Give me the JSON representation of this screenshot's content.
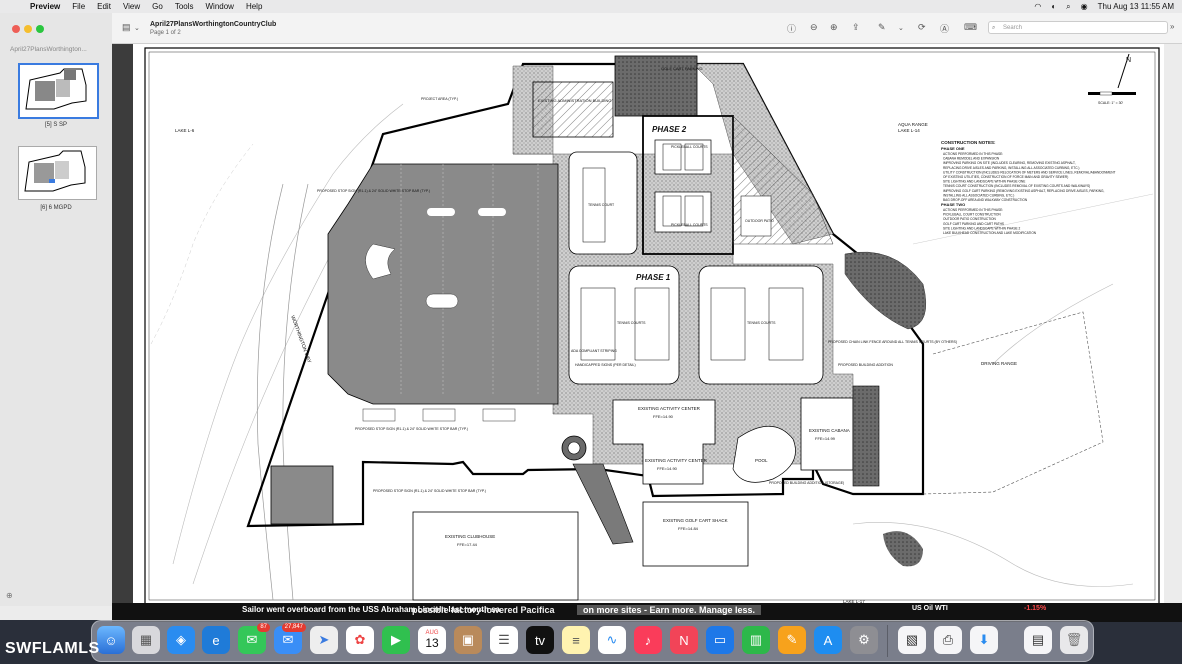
{
  "menubar": {
    "apple": "",
    "items": [
      "Preview",
      "File",
      "Edit",
      "View",
      "Go",
      "Tools",
      "Window",
      "Help"
    ],
    "clock": "Thu Aug 13  11:55 AM"
  },
  "sidebar": {
    "title": "April27PlansWorthington...",
    "thumbs": [
      {
        "label": "[5] S SP"
      },
      {
        "label": "[6] 6 MGPD"
      }
    ]
  },
  "toolbar": {
    "title": "April27PlansWorthingtonCountryClub",
    "subtitle": "Page 1 of 2",
    "search_placeholder": "Search"
  },
  "plan": {
    "phase1": "PHASE 1",
    "phase2": "PHASE 2",
    "admin": "EXISTING ADMINISTRATION BUILDING",
    "golf_cart_parking": "GOLF CART PARKING",
    "pickleball": "PICKLEBALL COURTS",
    "pickleball2": "PICKLEBALL COURTS",
    "outdoor_patio": "OUTDOOR PATIO",
    "tennis_court": "TENNIS COURT",
    "tennis_courts": "TENNIS COURTS",
    "tennis_courts2": "TENNIS COURTS",
    "activity1": "EXISTING ACTIVITY CENTER",
    "activity1_ffe": "FFE=14.90",
    "activity2": "EXISTING ACTIVITY CENTER",
    "activity2_ffe": "FFE=14.90",
    "pool": "POOL",
    "cabana": "EXISTING CABANA",
    "cabana_ffe": "FFE=14.99",
    "clubhouse": "EXISTING CLUBHOUSE",
    "clubhouse_ffe": "FFE=17.44",
    "cart_shack": "EXISTING GOLF CART SHACK",
    "cart_shack_ffe": "FFE=14.84",
    "driving_range": "DRIVING RANGE",
    "aqua_range": "AQUA RANGE",
    "lake_l14": "LAKE L-14",
    "lake_l6": "LAKE L-6",
    "lake_l17": "LAKE L-17",
    "worthington_way": "WORTHINGTON WAY",
    "project_area": "PROJECT AREA (TYP.)",
    "stop_sign": "PROPOSED STOP SIGN (R1-1) & 24\" SOLID WHITE STOP BAR (TYP.)",
    "ada_striping": "ADA COMPLIANT STRIPING",
    "hc_signs": "HANDICAPPED SIGNS (PER DETAIL)",
    "chain_fence": "PROPOSED CHAIN LINK FENCE AROUND ALL TENNIS COURTS (BY OTHERS)",
    "bldg_addition": "PROPOSED BUILDING ADDITION",
    "bldg_addition_storage": "PROPOSED BUILDING ADDITION (STORAGE)",
    "scale": "SCALE: 1\" = 30'",
    "notes_title": "CONSTRUCTION NOTES:",
    "phase_one_title": "PHASE ONE",
    "notes_p1": [
      "ACTIONS PERFORMED IN THIS PHASE:",
      "CABANA REMODEL AND EXPANSION",
      "IMPROVING PARKING ON SITE (INCLUDES CLEARING, REMOVING EXISTING ASPHALT,",
      "REPLACING DRIVE AISLES AND PARKING, INSTALLING ALL ASSOCIATED CURBING, ETC.)",
      "UTILITY CONSTRUCTION (INCLUDES RELOCATION OF METERS AND SERVICE LINES, REMOVAL/ABANDONMENT",
      "OF EXISTING UTILITIES, CONSTRUCTION OF FORCE MAIN AND GRAVITY SEWER)",
      "SITE LIGHTING AND LANDSCAPE WITHIN PHASE ONE",
      "TENNIS COURT CONSTRUCTION (INCLUDES REMOVAL OF EXISTING COURTS AND WALKWAYS)",
      "IMPROVING GOLF CART PARKING (REMOVING EXISTING ASPHALT, REPLACING DRIVE AISLES, PARKING,",
      "INSTALLING ALL ASSOCIATED CURBING, ETC.)",
      "BAG DROP-OFF AREA AND WALKWAY CONSTRUCTION"
    ],
    "phase_two_title": "PHASE TWO",
    "notes_p2": [
      "ACTIONS PERFORMED IN THIS PHASE:",
      "PICKLEBALL COURT CONSTRUCTION",
      "OUTDOOR PATIO CONSTRUCTION",
      "GOLF CART PARKING AND CART PATHS",
      "SITE LIGHTING AND LANDSCAPE WITHIN PHASE 2",
      "LAKE BULKHEAD CONSTRUCTION AND LAKE MODIFICATION"
    ]
  },
  "ticker": {
    "headline1": "Sailor went overboard from the USS Abraham Lincoln last month sa",
    "headline2": "possible factory-lowered Pacifica",
    "ad": "on more sites - Earn more. Manage less.",
    "market": "US Oil WTI",
    "market_change": "-1.15%"
  },
  "dock": {
    "badges": {
      "messages": "87",
      "mail": "27,847"
    },
    "calendar_month": "AUG",
    "calendar_day": "13"
  },
  "watermark": "SWFLAMLS"
}
